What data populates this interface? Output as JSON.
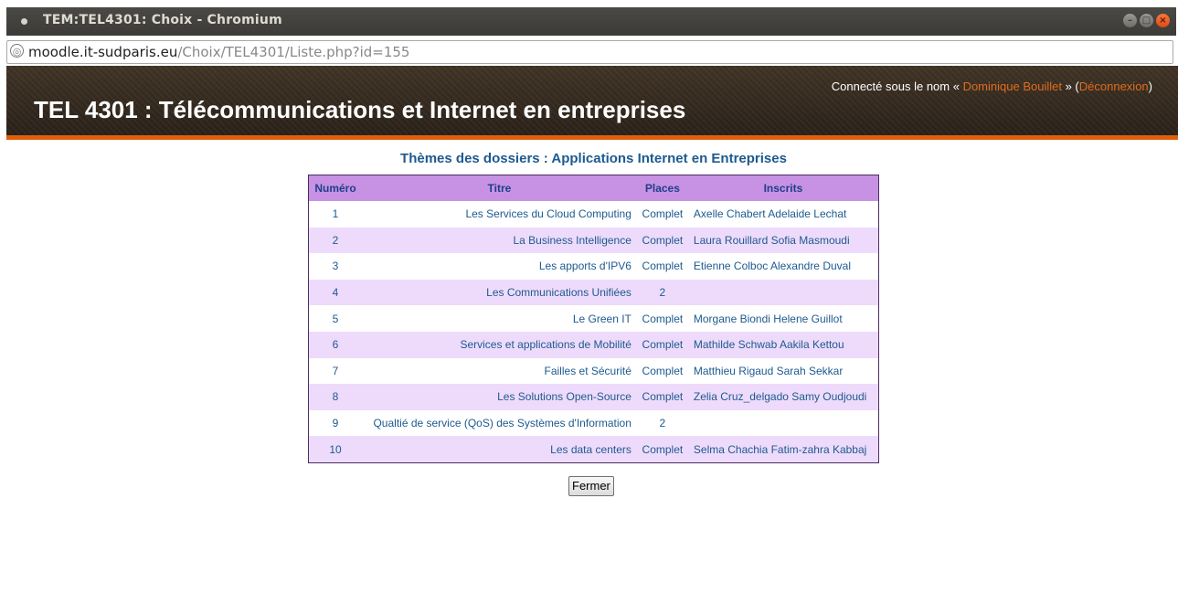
{
  "window": {
    "title": "TEM:TEL4301: Choix - Chromium",
    "buttons": [
      "–",
      "□",
      "×"
    ]
  },
  "urlbar": {
    "host": "moodle.it-sudparis.eu",
    "path": "/Choix/TEL4301/Liste.php?id=155"
  },
  "header": {
    "login_prefix": "Connecté sous le nom « ",
    "user_name": "Dominique Bouillet",
    "login_mid": " » (",
    "logout_label": "Déconnexion",
    "login_suffix": ")",
    "course_title": "TEL 4301 : Télécommunications et Internet en entreprises"
  },
  "main": {
    "title": "Thèmes des dossiers : Applications Internet en Entreprises",
    "columns": [
      "Numéro",
      "Titre",
      "Places",
      "Inscrits"
    ],
    "rows": [
      {
        "num": "1",
        "titre": "Les Services du Cloud Computing",
        "places": "Complet",
        "inscrits": "Axelle Chabert Adelaide Lechat"
      },
      {
        "num": "2",
        "titre": "La Business Intelligence",
        "places": "Complet",
        "inscrits": "Laura Rouillard Sofia Masmoudi"
      },
      {
        "num": "3",
        "titre": "Les apports d'IPV6",
        "places": "Complet",
        "inscrits": "Etienne Colboc Alexandre Duval"
      },
      {
        "num": "4",
        "titre": "Les Communications Unifiées",
        "places": "2",
        "inscrits": ""
      },
      {
        "num": "5",
        "titre": "Le Green IT",
        "places": "Complet",
        "inscrits": "Morgane Biondi Helene Guillot"
      },
      {
        "num": "6",
        "titre": "Services et applications de Mobilité",
        "places": "Complet",
        "inscrits": "Mathilde Schwab Aakila Kettou"
      },
      {
        "num": "7",
        "titre": "Failles et Sécurité",
        "places": "Complet",
        "inscrits": "Matthieu Rigaud Sarah Sekkar"
      },
      {
        "num": "8",
        "titre": "Les Solutions Open-Source",
        "places": "Complet",
        "inscrits": "Zelia Cruz_delgado Samy Oudjoudi"
      },
      {
        "num": "9",
        "titre": "Qualtié de service (QoS) des Systèmes d'Information",
        "places": "2",
        "inscrits": ""
      },
      {
        "num": "10",
        "titre": "Les data centers",
        "places": "Complet",
        "inscrits": "Selma Chachia Fatim-zahra Kabbaj"
      }
    ],
    "close_label": "Fermer"
  },
  "colors": {
    "header_bg": "#2a2119",
    "header_accent": "#df5f0b",
    "link": "#e06c1e",
    "table_header": "#c792e3",
    "table_even_row": "#eedbfb",
    "table_text": "#1d5a8f"
  }
}
